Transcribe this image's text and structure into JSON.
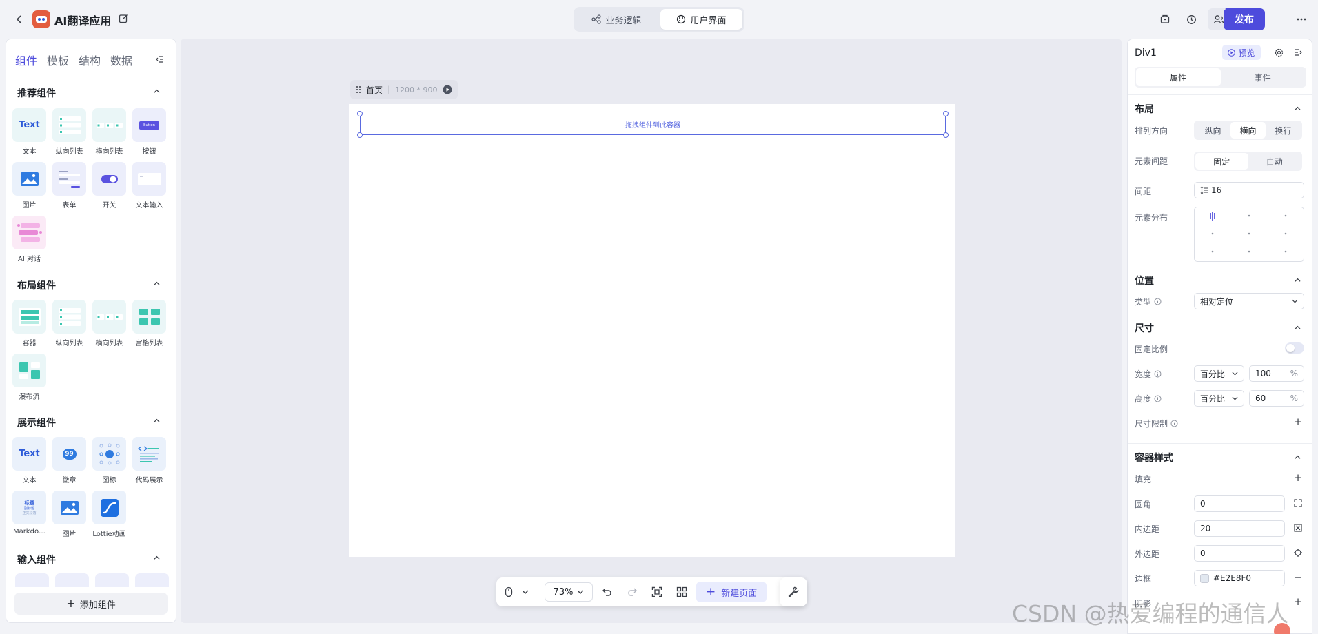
{
  "header": {
    "app_title": "AI翻译应用",
    "mode_tabs": [
      {
        "label": "业务逻辑",
        "active": false
      },
      {
        "label": "用户界面",
        "active": true
      }
    ],
    "publish_label": "发布"
  },
  "left_panel": {
    "tabs": [
      {
        "label": "组件",
        "active": true
      },
      {
        "label": "模板",
        "active": false
      },
      {
        "label": "结构",
        "active": false
      },
      {
        "label": "数据",
        "active": false
      }
    ],
    "sections": {
      "recommended": {
        "title": "推荐组件",
        "items": [
          "文本",
          "纵向列表",
          "横向列表",
          "按钮",
          "图片",
          "表单",
          "开关",
          "文本输入",
          "AI 对话"
        ]
      },
      "layout": {
        "title": "布局组件",
        "items": [
          "容器",
          "纵向列表",
          "横向列表",
          "宫格列表",
          "瀑布流"
        ]
      },
      "display": {
        "title": "展示组件",
        "items": [
          "文本",
          "徽章",
          "图标",
          "代码展示",
          "Markdo…",
          "图片",
          "Lottie动画"
        ]
      },
      "input": {
        "title": "输入组件"
      }
    },
    "tile_text": {
      "text": "Text",
      "badge_number": "99",
      "button": "Button",
      "md_title": "标题",
      "md_sub": "副标题",
      "md_body": "正文段落"
    },
    "add_component_label": "添加组件"
  },
  "canvas": {
    "page_name": "首页",
    "page_size": "1200 * 900",
    "drop_hint": "拖拽组件到此容器"
  },
  "bottom_toolbar": {
    "zoom": "73%",
    "new_page_label": "新建页面"
  },
  "right_panel": {
    "element_name": "Div1",
    "preview_label": "预览",
    "tabs": [
      {
        "label": "属性",
        "active": true
      },
      {
        "label": "事件",
        "active": false
      }
    ],
    "layout": {
      "title": "布局",
      "direction_label": "排列方向",
      "direction_options": [
        {
          "label": "纵向",
          "active": false
        },
        {
          "label": "横向",
          "active": true
        },
        {
          "label": "换行",
          "active": false
        }
      ],
      "gap_mode_label": "元素间距",
      "gap_mode_options": [
        {
          "label": "固定",
          "active": true
        },
        {
          "label": "自动",
          "active": false
        }
      ],
      "gap_label": "间距",
      "gap_value": "16",
      "distribution_label": "元素分布"
    },
    "position": {
      "title": "位置",
      "type_label": "类型",
      "type_value": "相对定位"
    },
    "size": {
      "title": "尺寸",
      "fixed_ratio_label": "固定比例",
      "fixed_ratio_on": false,
      "width_label": "宽度",
      "width_unit": "百分比",
      "width_value": "100",
      "height_label": "高度",
      "height_unit": "百分比",
      "height_value": "60",
      "percent_sign": "%",
      "limit_label": "尺寸限制"
    },
    "container_style": {
      "title": "容器样式",
      "fill_label": "填充",
      "radius_label": "圆角",
      "radius_value": "0",
      "padding_label": "内边距",
      "padding_value": "20",
      "margin_label": "外边距",
      "margin_value": "0",
      "border_label": "边框",
      "border_value": "#E2E8F0",
      "shadow_label": "阴影"
    }
  },
  "watermark": "CSDN @热爱编程的通信人",
  "colors": {
    "accent": "#4d4bdc",
    "canvas_bg": "#e9eaf1",
    "tile_bg": "#eaf6f7",
    "selection": "#5a6ae0"
  }
}
